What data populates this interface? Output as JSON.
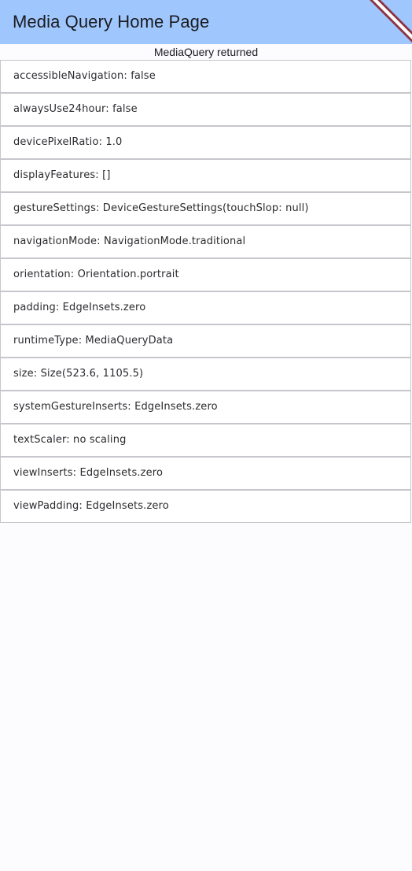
{
  "app_bar": {
    "title": "Media Query Home Page",
    "background": "#9fc7fe",
    "debug_banner_icon": "debug-banner-ribbon"
  },
  "subtitle": "MediaQuery returned",
  "items": [
    {
      "label": "accessibleNavigation: false"
    },
    {
      "label": "alwaysUse24hour: false"
    },
    {
      "label": "devicePixelRatio: 1.0"
    },
    {
      "label": "displayFeatures: []"
    },
    {
      "label": "gestureSettings: DeviceGestureSettings(touchSlop: null)"
    },
    {
      "label": "navigationMode: NavigationMode.traditional"
    },
    {
      "label": "orientation: Orientation.portrait"
    },
    {
      "label": "padding: EdgeInsets.zero"
    },
    {
      "label": "runtimeType: MediaQueryData"
    },
    {
      "label": "size: Size(523.6, 1105.5)"
    },
    {
      "label": "systemGestureInserts: EdgeInsets.zero"
    },
    {
      "label": "textScaler: no scaling"
    },
    {
      "label": "viewInserts: EdgeInsets.zero"
    },
    {
      "label": "viewPadding: EdgeInsets.zero"
    }
  ],
  "colors": {
    "page_background": "#fcfcff",
    "item_border": "#c6c6cc",
    "banner_red": "#8b3340"
  }
}
